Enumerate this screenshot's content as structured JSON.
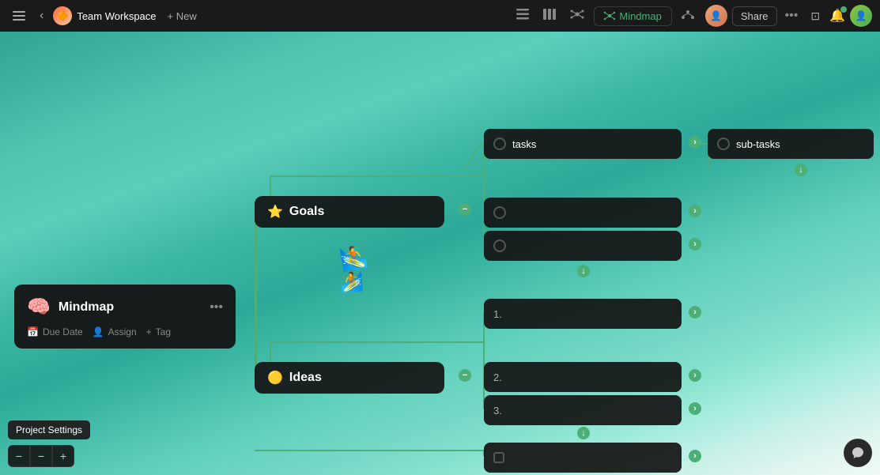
{
  "navbar": {
    "workspace_title": "Team Workspace",
    "new_label": "+ New",
    "mindmap_label": "Mindmap",
    "share_label": "Share",
    "views": [
      "list-view-icon",
      "board-view-icon",
      "mindmap-view-icon"
    ],
    "icons": {
      "menu": "☰",
      "back": "‹",
      "more_options": "•••",
      "network": "⋮⋮",
      "notification": "🔔",
      "mindmap_symbol": "⟲"
    }
  },
  "mindmap": {
    "central_node": {
      "label": "Mindmap",
      "icon": "🧠"
    },
    "branches": [
      {
        "id": "goals",
        "label": "Goals",
        "icon": "⭐",
        "children": [
          {
            "id": "tasks",
            "label": "tasks",
            "type": "circle"
          },
          {
            "id": "child2",
            "label": "",
            "type": "circle"
          },
          {
            "id": "child3",
            "label": "",
            "type": "circle"
          }
        ]
      },
      {
        "id": "ideas",
        "label": "Ideas",
        "icon": "🟡",
        "children": [
          {
            "id": "item1",
            "label": "1.",
            "type": "number"
          },
          {
            "id": "item2",
            "label": "2.",
            "type": "number"
          },
          {
            "id": "item3",
            "label": "3.",
            "type": "number"
          }
        ]
      },
      {
        "id": "branch3",
        "label": "",
        "icon": "",
        "children": [
          {
            "id": "check1",
            "label": "",
            "type": "checkbox"
          }
        ]
      }
    ],
    "sub_tasks_label": "sub-tasks"
  },
  "card": {
    "icon": "🧠",
    "title": "Mindmap",
    "actions": [
      {
        "icon": "📅",
        "label": "Due Date"
      },
      {
        "icon": "👤",
        "label": "Assign"
      },
      {
        "icon": "+",
        "label": "Tag"
      }
    ]
  },
  "bottom": {
    "project_settings_label": "Project Settings",
    "zoom_minus": "−",
    "zoom_plus": "+"
  }
}
